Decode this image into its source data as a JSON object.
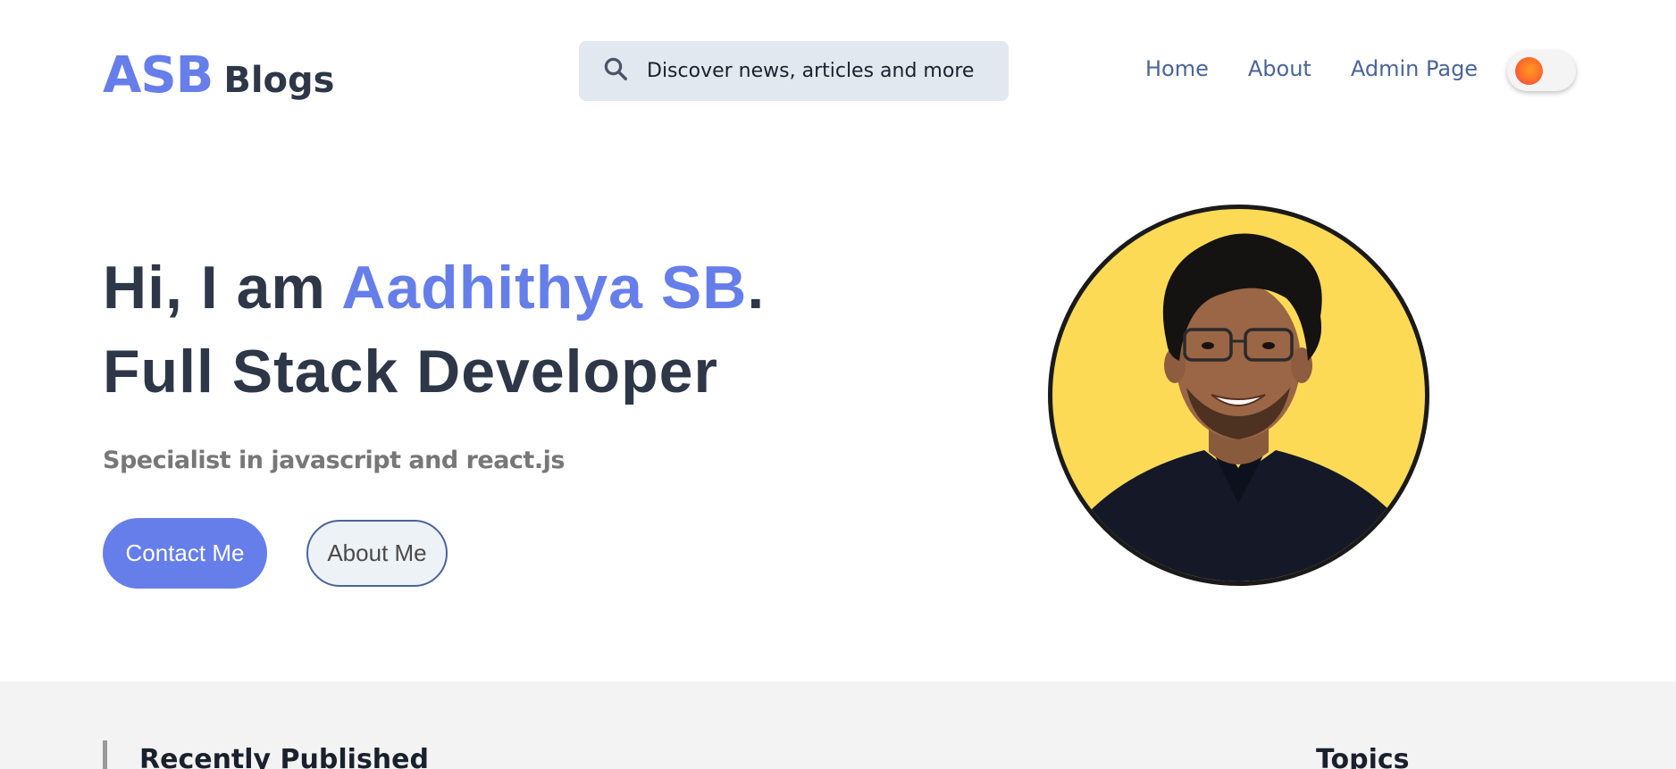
{
  "brand": {
    "name_accent": "ASB",
    "name_rest": "Blogs"
  },
  "search": {
    "placeholder": "Discover news, articles and more",
    "icon": "search-icon"
  },
  "nav": {
    "items": [
      {
        "label": "Home"
      },
      {
        "label": "About"
      },
      {
        "label": "Admin Page"
      }
    ]
  },
  "theme_toggle": {
    "icon": "sun-icon",
    "state": "light"
  },
  "hero": {
    "greeting_prefix": "Hi, I am ",
    "name": "Aadhithya SB",
    "greeting_suffix": ".",
    "role": "Full Stack Developer",
    "subtitle": "Specialist in javascript and react.js",
    "contact_button": "Contact Me",
    "about_button": "About Me"
  },
  "sections": {
    "recent_title": "Recently Published",
    "topics_title": "Topics"
  },
  "colors": {
    "accent": "#667eea",
    "text_dark": "#2d3748",
    "nav_link": "#4a6498",
    "avatar_bg": "#fdda56",
    "section_bg": "#f3f3f3"
  }
}
